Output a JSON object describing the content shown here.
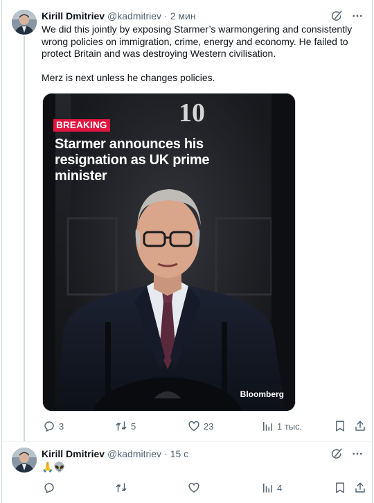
{
  "tweets": [
    {
      "author_name": "Kirill Dmitriev",
      "author_handle": "@kadmitriev",
      "separator": "·",
      "time": "2 мин",
      "text_paragraphs": [
        "We did this jointly by exposing Starmer’s warmongering and consistently wrong policies on immigration, crime, energy and economy. He failed to protect Britain and was destroying Western civilisation.",
        "Merz is next unless he changes policies."
      ],
      "media": {
        "badge": "BREAKING",
        "headline": "Starmer announces his resignation as UK prime minister",
        "brand": "Bloomberg",
        "door_number": "10"
      },
      "stats": {
        "replies": "3",
        "reposts": "5",
        "likes": "23",
        "views": "1 тыс."
      }
    },
    {
      "author_name": "Kirill Dmitriev",
      "author_handle": "@kadmitriev",
      "separator": "·",
      "time": "15 с",
      "emoji_text": "🙏👽",
      "stats": {
        "replies": "",
        "reposts": "",
        "likes": "",
        "views": "4"
      }
    }
  ],
  "icons": {
    "edit": "grok-icon",
    "more": "more-icon",
    "reply": "reply-icon",
    "repost": "repost-icon",
    "like": "heart-icon",
    "views": "views-icon",
    "bookmark": "bookmark-icon",
    "share": "share-icon"
  },
  "colors": {
    "badge": "#e0163f",
    "secondary_text": "#536471",
    "primary_text": "#0f1419"
  }
}
